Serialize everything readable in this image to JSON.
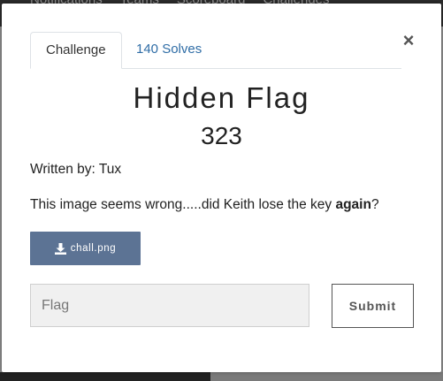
{
  "background_nav": {
    "items": [
      "Notifications",
      "Teams",
      "Scoreboard",
      "Challenges"
    ]
  },
  "modal": {
    "close_label": "×",
    "tabs": [
      {
        "label": "Challenge",
        "active": true
      },
      {
        "label": "140 Solves",
        "active": false
      }
    ],
    "challenge": {
      "name": "Hidden Flag",
      "points": "323",
      "author": "Written by: Tux",
      "description_before": "This image seems wrong.....did Keith lose the key ",
      "description_bold": "again",
      "description_after": "?"
    },
    "file": {
      "icon": "download-icon",
      "label": "chall.png"
    },
    "flag_input": {
      "placeholder": "Flag",
      "value": ""
    },
    "submit_label": "Submit"
  },
  "colors": {
    "file_button": "#5c7394",
    "tab_link": "#2f6da6",
    "overlay": "#8a8a8a"
  }
}
